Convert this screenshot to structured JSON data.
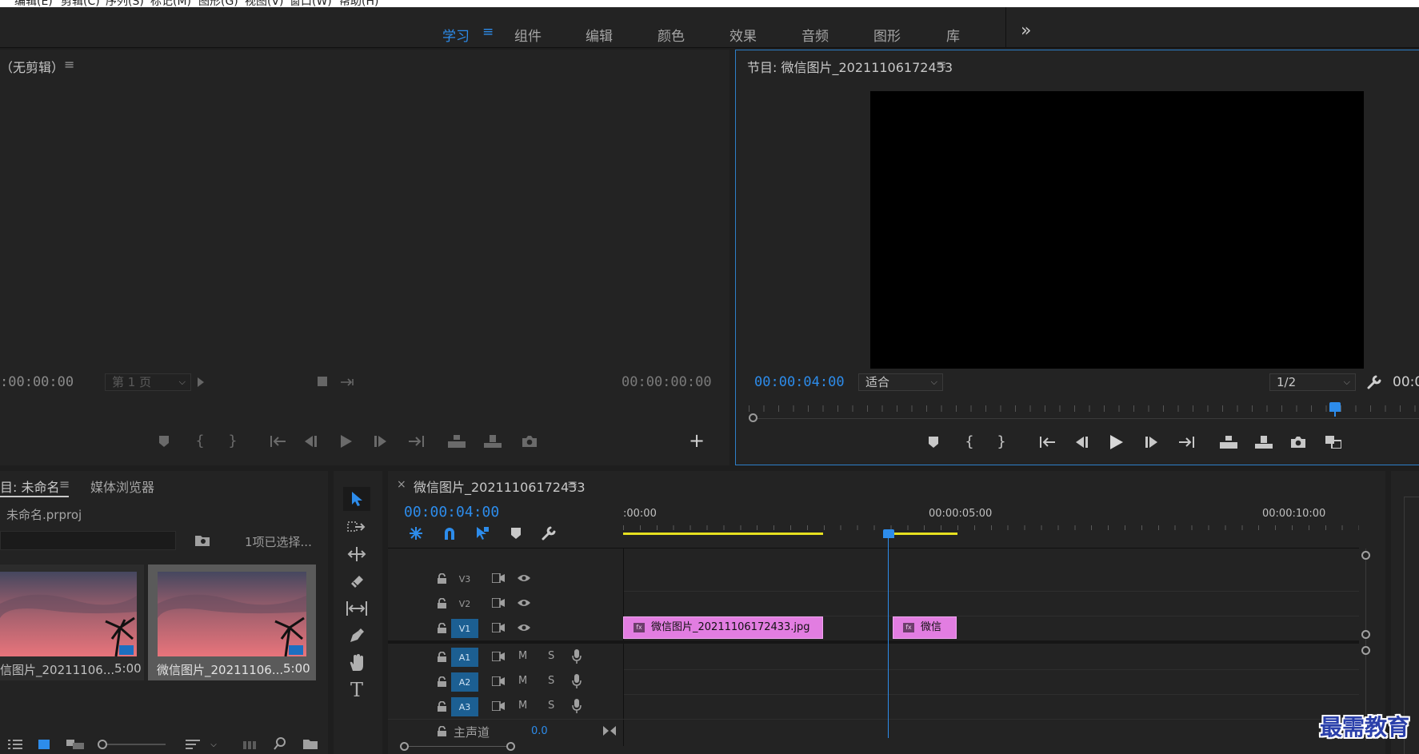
{
  "menu": {
    "items": [
      "编辑(E)",
      "剪辑(C)",
      "序列(S)",
      "标记(M)",
      "图形(G)",
      "视图(V)",
      "窗口(W)",
      "帮助(H)"
    ]
  },
  "workspaces": {
    "tabs": [
      "学习",
      "组件",
      "编辑",
      "颜色",
      "效果",
      "音频",
      "图形",
      "库"
    ],
    "active": "学习",
    "more": "»"
  },
  "source_monitor": {
    "title": "（无剪辑）",
    "menu_icon": "≡",
    "timecode_left": ":00:00:00",
    "page_select": "第 1 页",
    "timecode_right": "00:00:00:00",
    "add_button": "+"
  },
  "program_monitor": {
    "title": "节目: 微信图片_20211106172433",
    "menu_icon": "≡",
    "timecode": "00:00:04:00",
    "fit_select": "适合",
    "resolution_select": "1/2",
    "timecode_right": "00:0"
  },
  "project_panel": {
    "tab_project": "目: 未命名",
    "menu_icon": "≡",
    "tab_media_browser": "媒体浏览器",
    "project_file": "未命名.prproj",
    "selection_status": "1项已选择...",
    "items": [
      {
        "name": "信图片_20211106...",
        "duration": "5:00"
      },
      {
        "name": "微信图片_20211106...",
        "duration": "5:00"
      }
    ],
    "colors": {
      "sky_top": "#4a4c66",
      "sky_bottom": "#e2707a",
      "selected_bg": "#5a5a5a"
    }
  },
  "timeline": {
    "close": "×",
    "sequence_name": "微信图片_20211106172433",
    "menu_icon": "≡",
    "timecode": "00:00:04:00",
    "ruler_labels": [
      ":00:00",
      "00:00:05:00",
      "00:00:10:00"
    ],
    "video_tracks": [
      {
        "name": "V3",
        "on": false
      },
      {
        "name": "V2",
        "on": false
      },
      {
        "name": "V1",
        "on": true
      }
    ],
    "audio_tracks": [
      {
        "name": "A1",
        "mute": "M",
        "solo": "S"
      },
      {
        "name": "A2",
        "mute": "M",
        "solo": "S"
      },
      {
        "name": "A3",
        "mute": "M",
        "solo": "S"
      }
    ],
    "master": {
      "label": "主声道",
      "value": "0.0"
    },
    "clips": [
      {
        "name": "微信图片_20211106172433.jpg",
        "fx": "fx"
      },
      {
        "name": "微信",
        "fx": "fx"
      }
    ],
    "colors": {
      "clip": "#e27de1",
      "work_area": "#e6e020",
      "playhead": "#2d8ceb"
    }
  },
  "watermark": "最需教育"
}
